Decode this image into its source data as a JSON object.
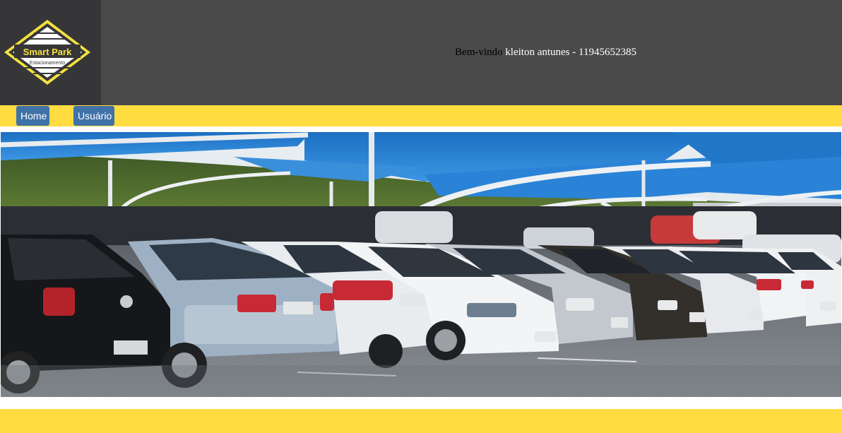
{
  "brand": {
    "logo_title": "Smart Park",
    "logo_subtitle": "Estacionamento"
  },
  "header": {
    "greeting": "Bem-vindo",
    "user_name": "kleiton antunes",
    "separator": " - ",
    "phone": "11945652385"
  },
  "nav": {
    "items": [
      {
        "label": "Home"
      },
      {
        "label": "Usuário"
      }
    ]
  },
  "colors": {
    "header_bg": "#4a4a4a",
    "logo_bg": "#363639",
    "accent_yellow": "#ffdc3f",
    "button_blue": "#3f72a8",
    "canopy_blue": "#2f7fcf"
  },
  "hero": {
    "image_subject": "parking-lot-photo"
  }
}
